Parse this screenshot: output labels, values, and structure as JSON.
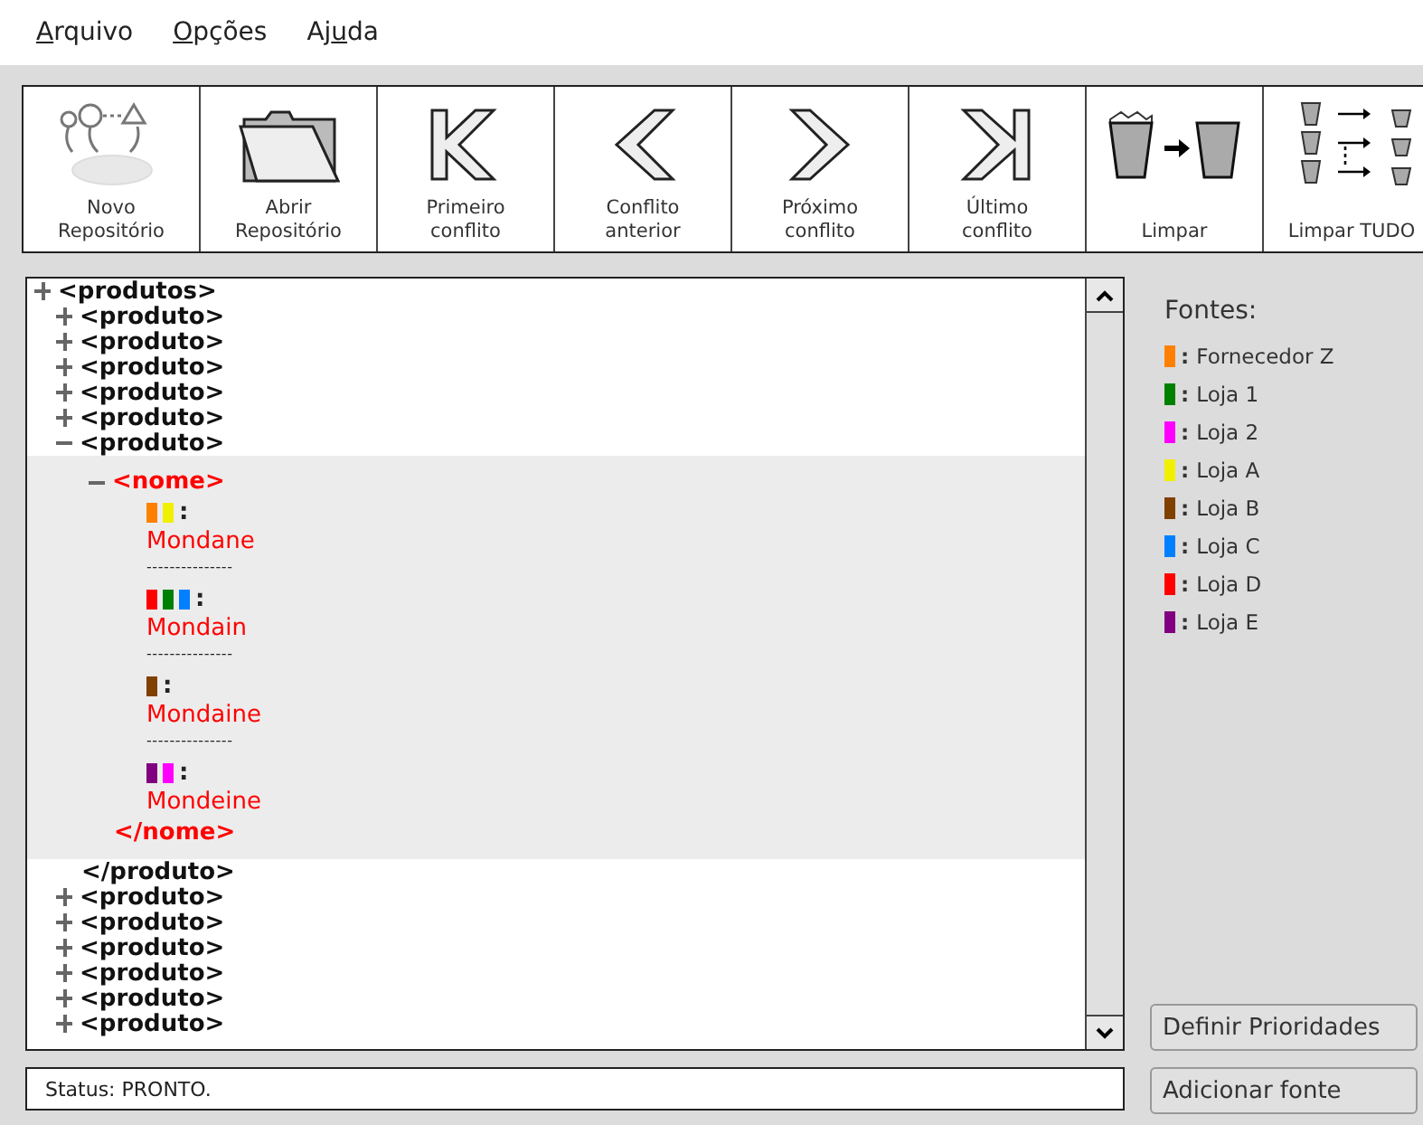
{
  "menu": [
    {
      "key": "A",
      "after": "rquivo"
    },
    {
      "key": "O",
      "after": "pções"
    },
    {
      "before": "Aj",
      "key": "u",
      "after": "da"
    }
  ],
  "toolbar": [
    {
      "kind": "new-repo",
      "label": "Novo\nRepositório"
    },
    {
      "kind": "open",
      "label": "Abrir\nRepositório"
    },
    {
      "kind": "first",
      "label": "Primeiro\nconflito"
    },
    {
      "kind": "prev",
      "label": "Conflito\nanterior"
    },
    {
      "kind": "next",
      "label": "Próximo\nconflito"
    },
    {
      "kind": "last",
      "label": "Último\nconflito"
    },
    {
      "kind": "clear",
      "label": "Limpar"
    },
    {
      "kind": "clear-all",
      "label": "Limpar TUDO"
    }
  ],
  "tree": {
    "nodes": [
      {
        "kind": "element",
        "tag": "<produtos>",
        "expanded": false,
        "children": [
          {
            "kind": "element",
            "tag": "<produto>",
            "expanded": false
          },
          {
            "kind": "element",
            "tag": "<produto>",
            "expanded": false
          },
          {
            "kind": "element",
            "tag": "<produto>",
            "expanded": false
          },
          {
            "kind": "element",
            "tag": "<produto>",
            "expanded": false
          },
          {
            "kind": "element",
            "tag": "<produto>",
            "expanded": false
          },
          {
            "kind": "element",
            "tag": "<produto>",
            "expanded": true,
            "close": "</produto>",
            "children": [
              {
                "kind": "conflict",
                "tag": "<nome>",
                "expanded": true,
                "close": "</nome>",
                "delimiter": ":",
                "separator": "---------------",
                "values": [
                  {
                    "swatches": [
                      {
                        "color": "#ff8000"
                      },
                      {
                        "color": "#f0f000"
                      }
                    ],
                    "text": "Mondane"
                  },
                  {
                    "swatches": [
                      {
                        "color": "#ff0000"
                      },
                      {
                        "color": "#008000"
                      },
                      {
                        "color": "#0080ff"
                      }
                    ],
                    "text": "Mondain"
                  },
                  {
                    "swatches": [
                      {
                        "color": "#804000"
                      }
                    ],
                    "text": "Mondaine"
                  },
                  {
                    "swatches": [
                      {
                        "color": "#800080"
                      },
                      {
                        "color": "#ff00ff"
                      }
                    ],
                    "text": "Mondeine"
                  }
                ]
              }
            ]
          },
          {
            "kind": "element",
            "tag": "<produto>",
            "expanded": false
          },
          {
            "kind": "element",
            "tag": "<produto>",
            "expanded": false
          },
          {
            "kind": "element",
            "tag": "<produto>",
            "expanded": false
          },
          {
            "kind": "element",
            "tag": "<produto>",
            "expanded": false
          },
          {
            "kind": "element",
            "tag": "<produto>",
            "expanded": false
          },
          {
            "kind": "element",
            "tag": "<produto>",
            "expanded": false
          }
        ]
      }
    ]
  },
  "sources": {
    "title": "Fontes:",
    "delimiter": ":",
    "items": [
      {
        "name": "Fornecedor Z",
        "color": "#ff8000"
      },
      {
        "name": "Loja 1",
        "color": "#008000"
      },
      {
        "name": "Loja 2",
        "color": "#ff00ff"
      },
      {
        "name": "Loja A",
        "color": "#f0f000"
      },
      {
        "name": "Loja B",
        "color": "#804000"
      },
      {
        "name": "Loja C",
        "color": "#0080ff"
      },
      {
        "name": "Loja D",
        "color": "#ff0000"
      },
      {
        "name": "Loja E",
        "color": "#800080"
      }
    ]
  },
  "buttons": [
    "Definir Prioridades",
    "Adicionar fonte"
  ],
  "status_bar": {
    "text": "Status: PRONTO."
  }
}
